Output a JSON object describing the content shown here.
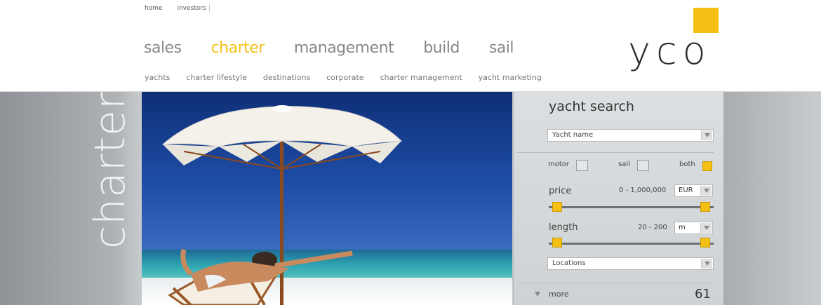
{
  "util_nav": [
    "home",
    "investors"
  ],
  "main_nav": [
    {
      "label": "sales",
      "active": false
    },
    {
      "label": "charter",
      "active": true
    },
    {
      "label": "management",
      "active": false
    },
    {
      "label": "build",
      "active": false
    },
    {
      "label": "sail",
      "active": false
    }
  ],
  "sub_nav": [
    "yachts",
    "charter lifestyle",
    "destinations",
    "corporate",
    "charter management",
    "yacht marketing"
  ],
  "logo": {
    "text": "yco"
  },
  "section_title": "charter",
  "search": {
    "title": "yacht search",
    "yacht_name_placeholder": "Yacht name",
    "types": [
      {
        "label": "motor",
        "checked": false
      },
      {
        "label": "sail",
        "checked": false
      },
      {
        "label": "both",
        "checked": true
      }
    ],
    "price": {
      "label": "price",
      "range": "0 - 1,000,000",
      "unit": "EUR",
      "low": 0,
      "high": 1
    }
  },
  "length": {
    "label": "length",
    "range": "20 - 200",
    "unit": "m"
  },
  "locations_placeholder": "Locations",
  "more_label": "more",
  "result_count": "61",
  "colors": {
    "accent": "#f5c013",
    "nav_inactive": "#888888"
  }
}
